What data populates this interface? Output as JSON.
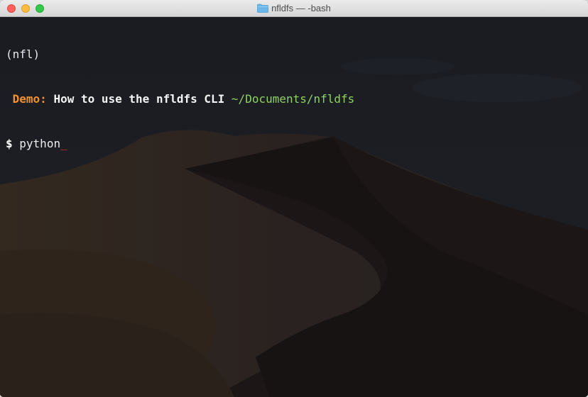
{
  "window": {
    "title": "nfldfs — -bash",
    "folder_icon": "folder-icon",
    "buttons": {
      "close": "close-button",
      "minimize": "minimize-button",
      "zoom": "zoom-button"
    }
  },
  "terminal": {
    "env_line": "(nfl)",
    "prompt": {
      "label": "Demo:",
      "message": "How to use the nfldfs CLI",
      "path": "~/Documents/nfldfs"
    },
    "input": {
      "symbol": "$",
      "command": "python",
      "cursor": "_"
    }
  },
  "colors": {
    "terminal_bg": "#1a1b1f",
    "demo_label": "#f0922f",
    "path": "#8fd163",
    "cursor": "#e0332f"
  }
}
